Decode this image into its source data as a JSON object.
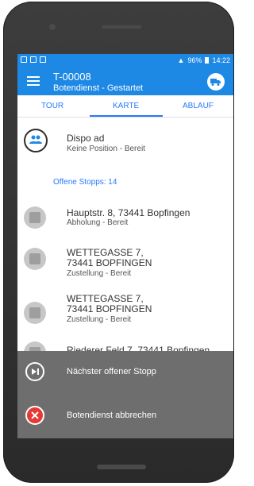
{
  "status_bar": {
    "signal_text": "96%",
    "time": "14:22"
  },
  "app_bar": {
    "title": "T-00008",
    "subtitle": "Botendienst - Gestartet"
  },
  "tabs": [
    {
      "label": "TOUR"
    },
    {
      "label": "KARTE",
      "selected": true
    },
    {
      "label": "ABLAUF"
    }
  ],
  "dispo": {
    "title": "Dispo ad",
    "subtitle": "Keine Position - Bereit"
  },
  "section_header": "Offene Stopps: 14",
  "stops": [
    {
      "title": "Hauptstr. 8, 73441 Bopfingen",
      "subtitle": "Abholung - Bereit"
    },
    {
      "title": "WETTEGASSE 7, 73441 BOPFINGEN",
      "subtitle": "Zustellung - Bereit"
    },
    {
      "title": "WETTEGASSE 7, 73441 BOPFINGEN",
      "subtitle": "Zustellung - Bereit"
    },
    {
      "title": "Riederer Feld 7, 73441 Bopfingen",
      "subtitle": ""
    }
  ],
  "actions": [
    {
      "label": "Nächster offener Stopp",
      "icon": "skip-next-icon"
    },
    {
      "label": "Botendienst abbrechen",
      "icon": "cancel-icon"
    }
  ],
  "colors": {
    "primary": "#1e88e5",
    "tab_accent": "#2979ff",
    "overlay": "#6e6e6e",
    "cancel_red": "#e53935"
  }
}
